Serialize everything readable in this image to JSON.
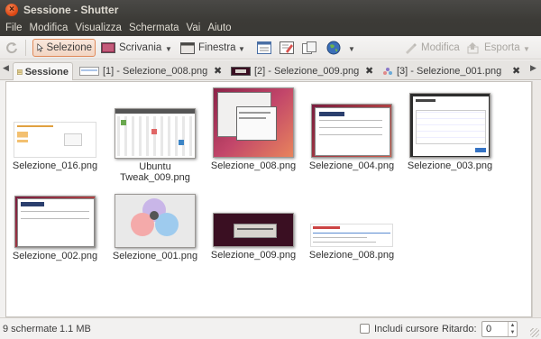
{
  "window": {
    "title": "Sessione - Shutter"
  },
  "menu": [
    "File",
    "Modifica",
    "Visualizza",
    "Schermata",
    "Vai",
    "Aiuto"
  ],
  "toolbar": {
    "selection": "Selezione",
    "desktop": "Scrivania",
    "window": "Finestra",
    "edit": "Modifica",
    "export": "Esporta"
  },
  "tabs": {
    "session": "Sessione",
    "items": [
      {
        "label": "[1] - Selezione_008.png"
      },
      {
        "label": "[2] - Selezione_009.png"
      },
      {
        "label": "[3] - Selezione_001.png"
      }
    ]
  },
  "thumbnails": [
    {
      "caption": "Selezione_016.png"
    },
    {
      "caption": "Ubuntu Tweak_009.png"
    },
    {
      "caption": "Selezione_008.png"
    },
    {
      "caption": "Selezione_004.png"
    },
    {
      "caption": "Selezione_003.png"
    },
    {
      "caption": "Selezione_002.png"
    },
    {
      "caption": "Selezione_001.png"
    },
    {
      "caption": "Selezione_009.png"
    },
    {
      "caption": "Selezione_008.png"
    }
  ],
  "status": {
    "count": "9 schermate",
    "size": "1.1 MB",
    "include_cursor": "Includi cursore",
    "delay_label": "Ritardo:",
    "delay_value": "0"
  }
}
